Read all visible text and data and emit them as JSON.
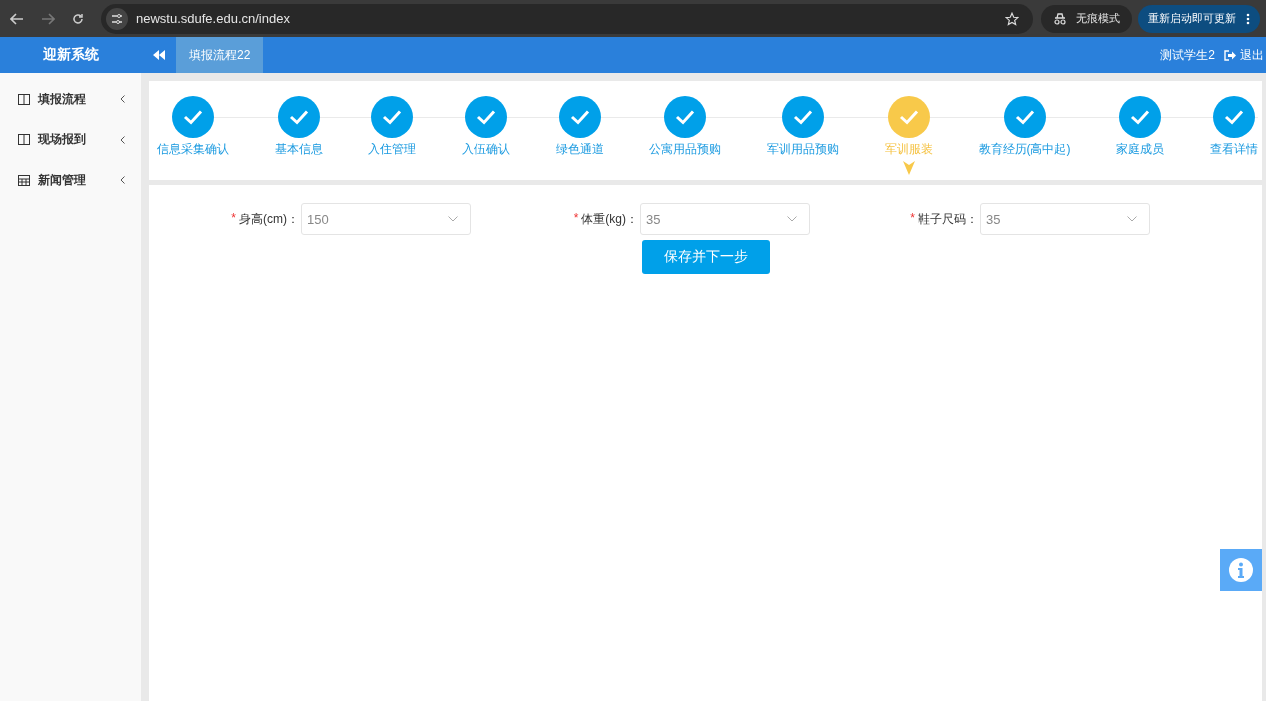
{
  "browser": {
    "url": "newstu.sdufe.edu.cn/index",
    "incognito_label": "无痕模式",
    "update_button": "重新启动即可更新"
  },
  "header": {
    "app_title": "迎新系统",
    "tabs": [
      {
        "label": "填报流程22",
        "selected": true
      }
    ],
    "user": "测试学生2",
    "logout": "退出"
  },
  "sidebar": {
    "items": [
      {
        "label": "填报流程",
        "kind": "panel"
      },
      {
        "label": "现场报到",
        "kind": "panel"
      },
      {
        "label": "新闻管理",
        "kind": "grid"
      }
    ]
  },
  "steps": [
    {
      "label": "信息采集确认",
      "selected": false
    },
    {
      "label": "基本信息",
      "selected": false
    },
    {
      "label": "入住管理",
      "selected": false
    },
    {
      "label": "入伍确认",
      "selected": false
    },
    {
      "label": "绿色通道",
      "selected": false
    },
    {
      "label": "公寓用品预购",
      "selected": false
    },
    {
      "label": "军训用品预购",
      "selected": false
    },
    {
      "label": "军训服装",
      "selected": true
    },
    {
      "label": "教育经历(高中起)",
      "selected": false
    },
    {
      "label": "家庭成员",
      "selected": false
    },
    {
      "label": "查看详情",
      "selected": false
    }
  ],
  "form": {
    "fields": [
      {
        "required_mark": "*",
        "label": "身高(cm)：",
        "value": "150"
      },
      {
        "required_mark": "*",
        "label": "体重(kg)：",
        "value": "35"
      },
      {
        "required_mark": "*",
        "label": "鞋子尺码：",
        "value": "35"
      }
    ],
    "submit_button": "保存并下一步"
  }
}
